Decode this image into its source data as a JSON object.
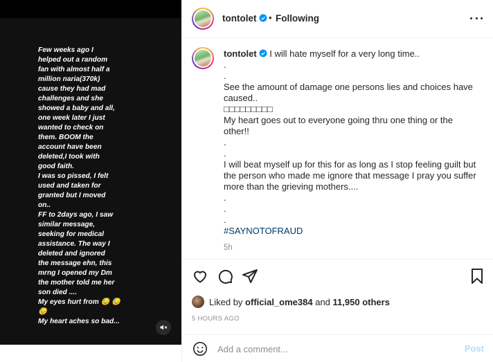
{
  "media": {
    "story_text": "Few weeks ago I\nhelped out a random\nfan with almost half a\nmillion naria(370k)\ncause they had mad\nchallenges and she\nshowed a baby and all,\none week later I just\nwanted to check on\nthem. BOOM the\naccount have been\ndeleted,I took with\ngood faith.\nI was so pissed, I felt\nused and taken for\ngranted but I moved\non..\nFF to 2days ago, I saw\nsimilar message,\nseeking for medical\nassistance. The way I\ndeleted and ignored\nthe message ehn, this\nmrng I opened my Dm\nthe mother told me her\nson died ....\nMy eyes hurt from 😓 😓\n😓\nMy heart aches so bad...",
    "mute_icon": "speaker-muted-icon"
  },
  "header": {
    "username": "tontolet",
    "separator": "•",
    "follow_status": "Following"
  },
  "caption": {
    "username": "tontolet",
    "text": "I will hate myself for a very long time..\n.\n.\nSee the amount of damage one persons lies and choices have caused..\n□□□□□□□□□\nMy heart goes out to everyone going thru one thing or the other!!\n.\n.\nI will beat myself up for this for as long as I stop feeling guilt but the person who made me ignore that message I pray you suffer more than the grieving mothers....\n.\n.\n.",
    "hashtag": "#SAYNOTOFRAUD",
    "age": "5h"
  },
  "likes": {
    "prefix": "Liked by",
    "user": "official_ome384",
    "conjunction": "and",
    "others": "11,950 others"
  },
  "timestamp": "5 HOURS AGO",
  "comment": {
    "placeholder": "Add a comment...",
    "post_label": "Post"
  },
  "colors": {
    "verified": "#0095f6",
    "link": "#00376b",
    "muted": "#8e8e8e",
    "post_disabled": "#b2dffc"
  }
}
